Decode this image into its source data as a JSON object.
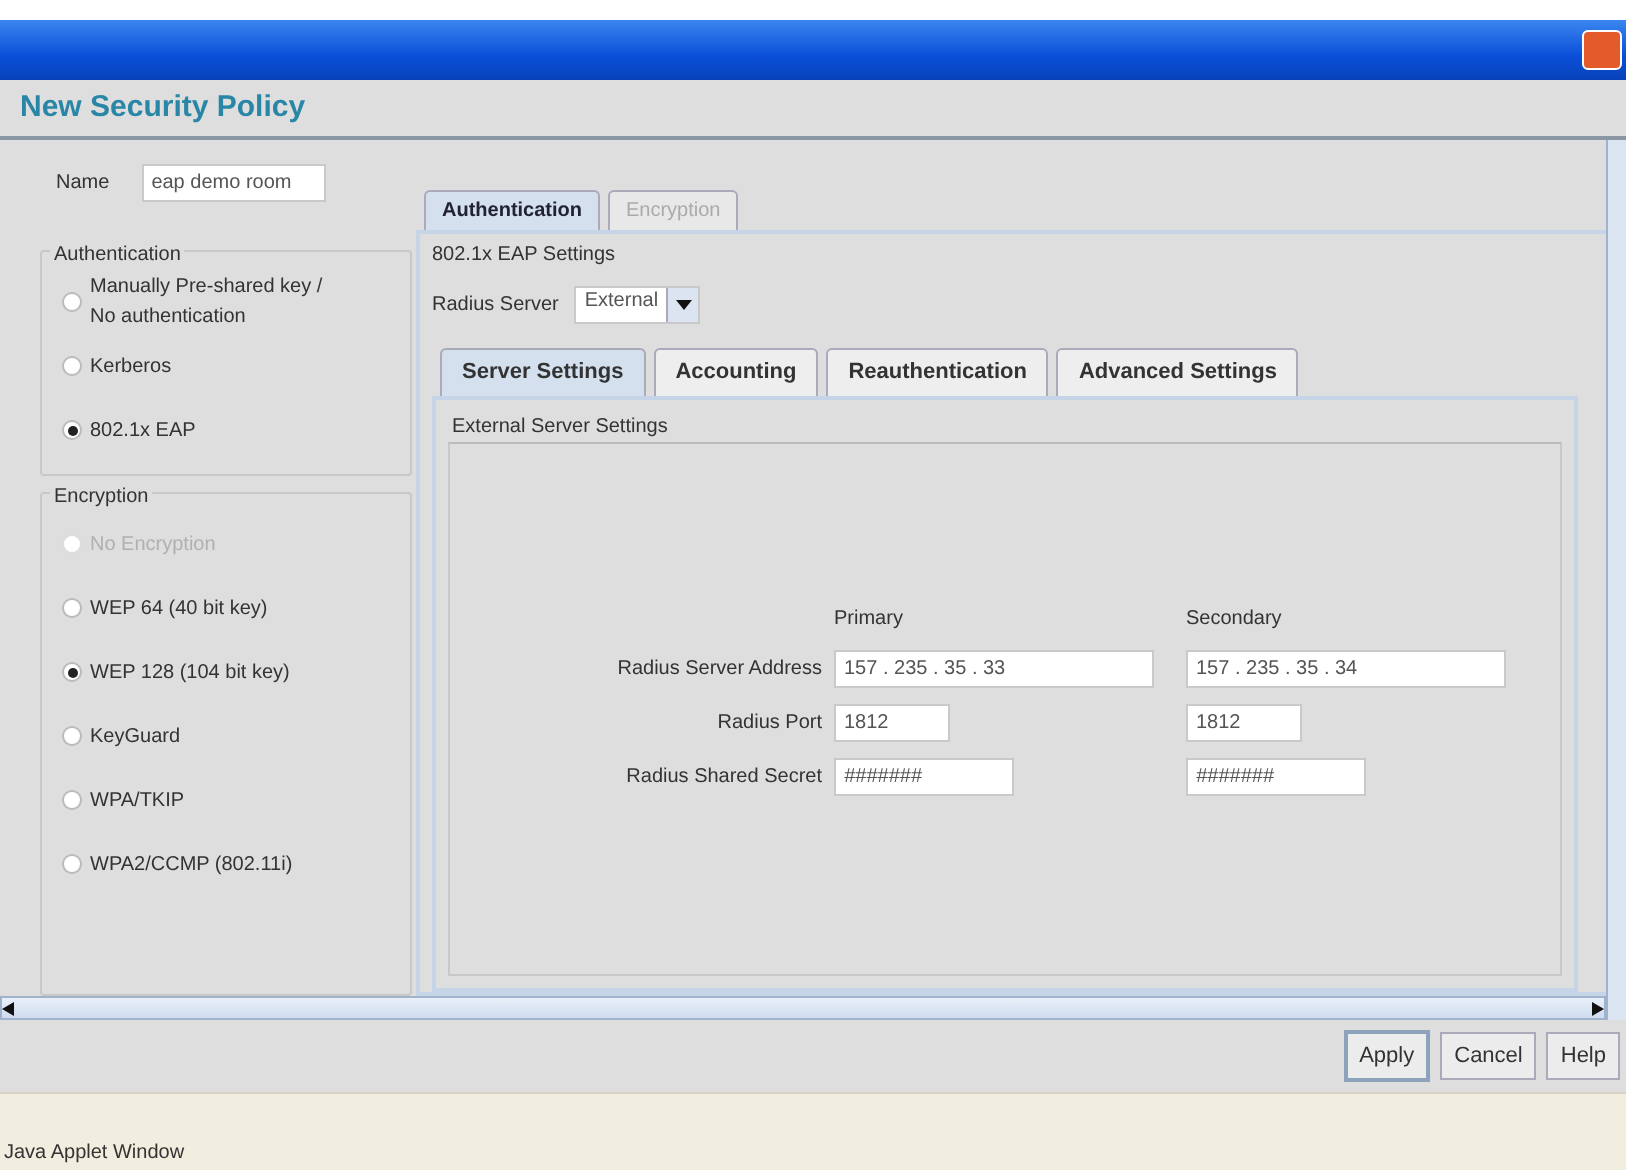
{
  "window": {
    "title": "New Security Policy"
  },
  "name_field": {
    "label": "Name",
    "value": "eap demo room"
  },
  "authentication": {
    "title": "Authentication",
    "options": [
      {
        "label": "Manually Pre-shared key / No authentication",
        "selected": false,
        "disabled": false
      },
      {
        "label": "Kerberos",
        "selected": false,
        "disabled": false
      },
      {
        "label": "802.1x EAP",
        "selected": true,
        "disabled": false
      }
    ]
  },
  "encryption": {
    "title": "Encryption",
    "options": [
      {
        "label": "No Encryption",
        "selected": false,
        "disabled": true
      },
      {
        "label": "WEP 64 (40 bit key)",
        "selected": false,
        "disabled": false
      },
      {
        "label": "WEP 128 (104 bit key)",
        "selected": true,
        "disabled": false
      },
      {
        "label": "KeyGuard",
        "selected": false,
        "disabled": false
      },
      {
        "label": "WPA/TKIP",
        "selected": false,
        "disabled": false
      },
      {
        "label": "WPA2/CCMP (802.11i)",
        "selected": false,
        "disabled": false
      }
    ]
  },
  "tabs": [
    {
      "label": "Authentication",
      "selected": true
    },
    {
      "label": "Encryption",
      "selected": false
    }
  ],
  "eap_settings": {
    "title": "802.1x EAP Settings",
    "radius_label": "Radius Server",
    "radius_value": "External"
  },
  "inner_tabs": [
    {
      "label": "Server Settings",
      "selected": true
    },
    {
      "label": "Accounting",
      "selected": false
    },
    {
      "label": "Reauthentication",
      "selected": false
    },
    {
      "label": "Advanced Settings",
      "selected": false
    }
  ],
  "server_settings": {
    "title": "External Server Settings",
    "columns": [
      "Primary",
      "Secondary"
    ],
    "rows": [
      {
        "label": "Radius Server Address",
        "primary": "157 . 235 . 35 . 33",
        "secondary": "157 . 235 . 35 . 34",
        "kind": "address"
      },
      {
        "label": "Radius Port",
        "primary": "1812",
        "secondary": "1812",
        "kind": "port"
      },
      {
        "label": "Radius Shared Secret",
        "primary": "#######",
        "secondary": "#######",
        "kind": "secret"
      }
    ]
  },
  "buttons": [
    "Apply",
    "Cancel",
    "Help"
  ],
  "status_bar": "Java Applet Window"
}
